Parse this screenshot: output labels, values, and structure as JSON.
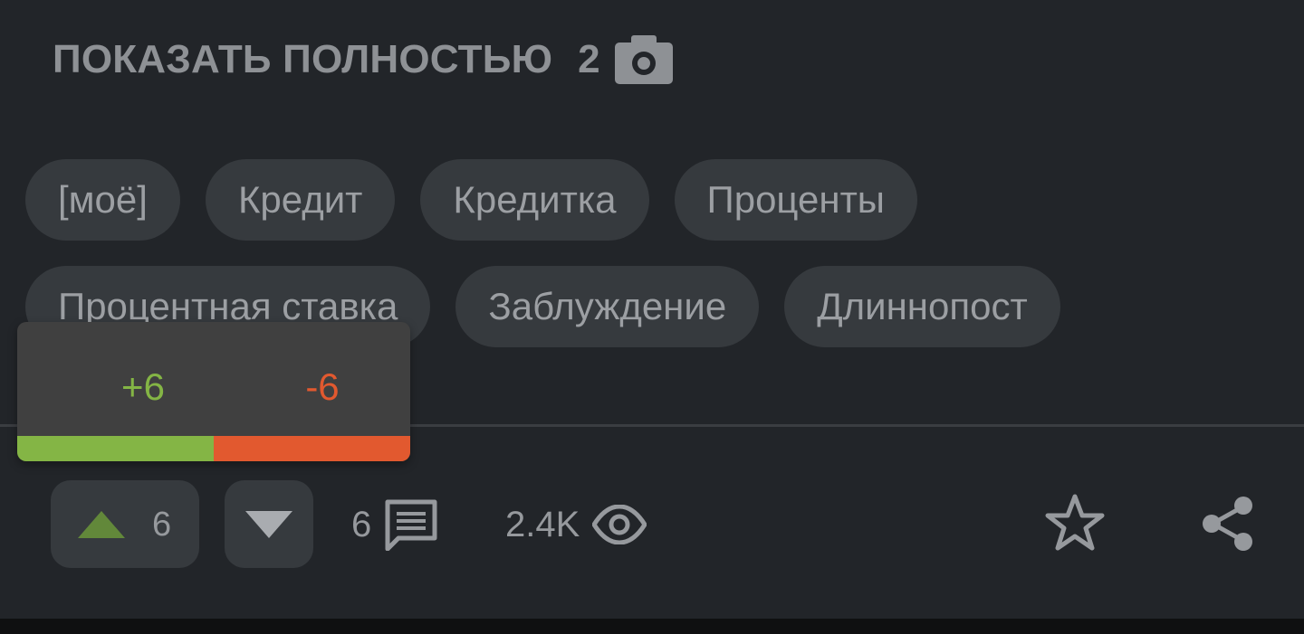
{
  "post": {
    "show_full_label": "ПОКАЗАТЬ ПОЛНОСТЬЮ",
    "photo_count": "2"
  },
  "tags": {
    "row1": [
      "[моё]",
      "Кредит",
      "Кредитка",
      "Проценты"
    ],
    "row2": [
      "Процентная ставка",
      "Заблуждение",
      "Длиннопост"
    ]
  },
  "rating_popup": {
    "plus": "+6",
    "minus": "-6",
    "plus_fraction": 0.5
  },
  "actions": {
    "upvote_count": "6",
    "comments_count": "6",
    "views_count": "2.4K"
  },
  "icons": {
    "camera": "camera-icon",
    "upvote": "triangle-up-icon",
    "downvote": "triangle-down-icon",
    "comments": "comment-icon",
    "views": "eye-icon",
    "save": "star-icon",
    "share": "share-icon"
  },
  "colors": {
    "background": "#222529",
    "chip": "#363a3e",
    "positive": "#84b545",
    "negative": "#e2592f",
    "text": "#9a9da1"
  }
}
